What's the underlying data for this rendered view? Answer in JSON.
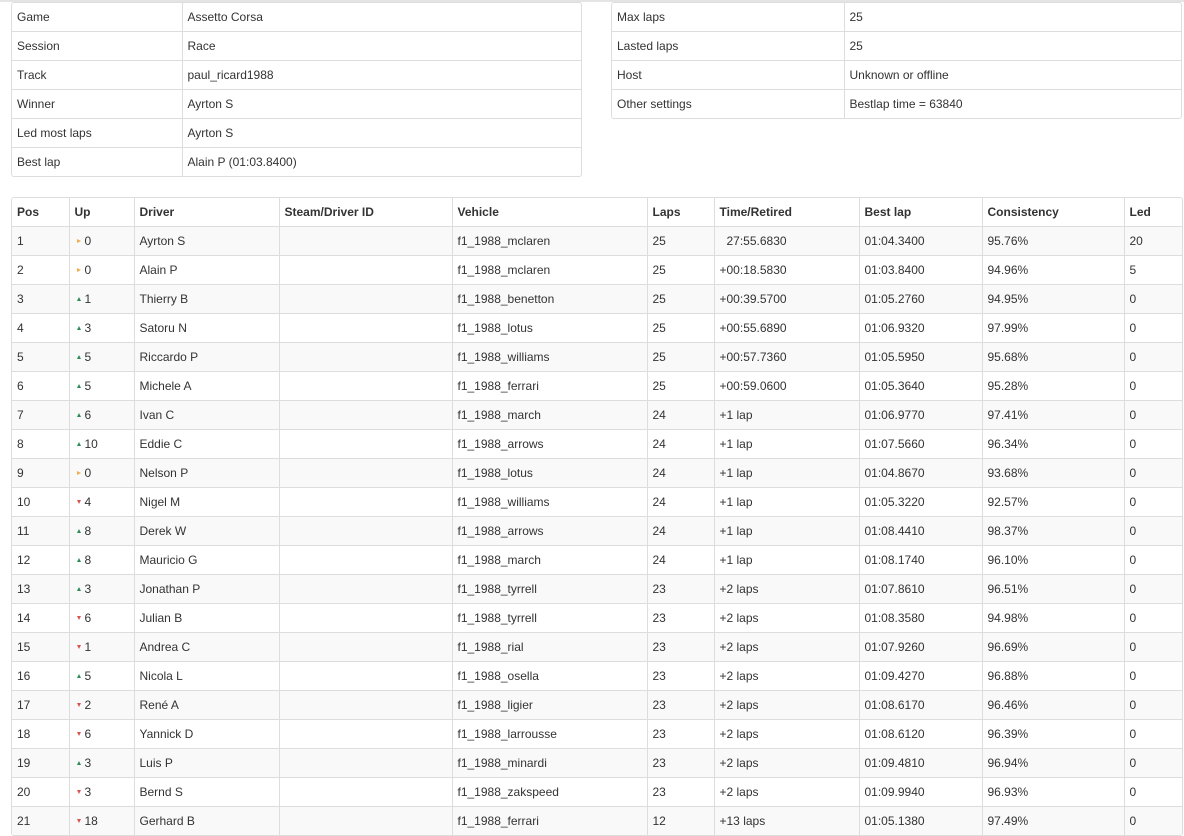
{
  "colors": {
    "border": "#dddddd",
    "stripe": "#f9f9f9",
    "up": "#2e8b57",
    "down": "#d9534f",
    "same": "#f0ad4e"
  },
  "icons": {
    "up": "triangle-up-icon",
    "down": "triangle-down-icon",
    "same": "triangle-right-icon"
  },
  "session_info": [
    {
      "label": "Game",
      "value": "Assetto Corsa"
    },
    {
      "label": "Session",
      "value": "Race"
    },
    {
      "label": "Track",
      "value": "paul_ricard1988"
    },
    {
      "label": "Winner",
      "value": "Ayrton S"
    },
    {
      "label": "Led most laps",
      "value": "Ayrton S"
    },
    {
      "label": "Best lap",
      "value": "Alain P (01:03.8400)"
    }
  ],
  "race_settings": [
    {
      "label": "Max laps",
      "value": "25"
    },
    {
      "label": "Lasted laps",
      "value": "25"
    },
    {
      "label": "Host",
      "value": "Unknown or offline"
    },
    {
      "label": "Other settings",
      "value": "Bestlap time = 63840"
    }
  ],
  "results": {
    "columns": [
      "Pos",
      "Up",
      "Driver",
      "Steam/Driver ID",
      "Vehicle",
      "Laps",
      "Time/Retired",
      "Best lap",
      "Consistency",
      "Led"
    ],
    "rows": [
      {
        "pos": "1",
        "up_dir": "same",
        "up": "0",
        "driver": "Ayrton S",
        "steam_id": "",
        "vehicle": "f1_1988_mclaren",
        "laps": "25",
        "time": "27:55.6830",
        "best_lap": "01:04.3400",
        "consistency": "95.76%",
        "led": "20"
      },
      {
        "pos": "2",
        "up_dir": "same",
        "up": "0",
        "driver": "Alain P",
        "steam_id": "",
        "vehicle": "f1_1988_mclaren",
        "laps": "25",
        "time": "+00:18.5830",
        "best_lap": "01:03.8400",
        "consistency": "94.96%",
        "led": "5"
      },
      {
        "pos": "3",
        "up_dir": "up",
        "up": "1",
        "driver": "Thierry B",
        "steam_id": "",
        "vehicle": "f1_1988_benetton",
        "laps": "25",
        "time": "+00:39.5700",
        "best_lap": "01:05.2760",
        "consistency": "94.95%",
        "led": "0"
      },
      {
        "pos": "4",
        "up_dir": "up",
        "up": "3",
        "driver": "Satoru N",
        "steam_id": "",
        "vehicle": "f1_1988_lotus",
        "laps": "25",
        "time": "+00:55.6890",
        "best_lap": "01:06.9320",
        "consistency": "97.99%",
        "led": "0"
      },
      {
        "pos": "5",
        "up_dir": "up",
        "up": "5",
        "driver": "Riccardo P",
        "steam_id": "",
        "vehicle": "f1_1988_williams",
        "laps": "25",
        "time": "+00:57.7360",
        "best_lap": "01:05.5950",
        "consistency": "95.68%",
        "led": "0"
      },
      {
        "pos": "6",
        "up_dir": "up",
        "up": "5",
        "driver": "Michele A",
        "steam_id": "",
        "vehicle": "f1_1988_ferrari",
        "laps": "25",
        "time": "+00:59.0600",
        "best_lap": "01:05.3640",
        "consistency": "95.28%",
        "led": "0"
      },
      {
        "pos": "7",
        "up_dir": "up",
        "up": "6",
        "driver": "Ivan C",
        "steam_id": "",
        "vehicle": "f1_1988_march",
        "laps": "24",
        "time": "+1 lap",
        "best_lap": "01:06.9770",
        "consistency": "97.41%",
        "led": "0"
      },
      {
        "pos": "8",
        "up_dir": "up",
        "up": "10",
        "driver": "Eddie C",
        "steam_id": "",
        "vehicle": "f1_1988_arrows",
        "laps": "24",
        "time": "+1 lap",
        "best_lap": "01:07.5660",
        "consistency": "96.34%",
        "led": "0"
      },
      {
        "pos": "9",
        "up_dir": "same",
        "up": "0",
        "driver": "Nelson P",
        "steam_id": "",
        "vehicle": "f1_1988_lotus",
        "laps": "24",
        "time": "+1 lap",
        "best_lap": "01:04.8670",
        "consistency": "93.68%",
        "led": "0"
      },
      {
        "pos": "10",
        "up_dir": "down",
        "up": "4",
        "driver": "Nigel M",
        "steam_id": "",
        "vehicle": "f1_1988_williams",
        "laps": "24",
        "time": "+1 lap",
        "best_lap": "01:05.3220",
        "consistency": "92.57%",
        "led": "0"
      },
      {
        "pos": "11",
        "up_dir": "up",
        "up": "8",
        "driver": "Derek W",
        "steam_id": "",
        "vehicle": "f1_1988_arrows",
        "laps": "24",
        "time": "+1 lap",
        "best_lap": "01:08.4410",
        "consistency": "98.37%",
        "led": "0"
      },
      {
        "pos": "12",
        "up_dir": "up",
        "up": "8",
        "driver": "Mauricio G",
        "steam_id": "",
        "vehicle": "f1_1988_march",
        "laps": "24",
        "time": "+1 lap",
        "best_lap": "01:08.1740",
        "consistency": "96.10%",
        "led": "0"
      },
      {
        "pos": "13",
        "up_dir": "up",
        "up": "3",
        "driver": "Jonathan P",
        "steam_id": "",
        "vehicle": "f1_1988_tyrrell",
        "laps": "23",
        "time": "+2 laps",
        "best_lap": "01:07.8610",
        "consistency": "96.51%",
        "led": "0"
      },
      {
        "pos": "14",
        "up_dir": "down",
        "up": "6",
        "driver": "Julian B",
        "steam_id": "",
        "vehicle": "f1_1988_tyrrell",
        "laps": "23",
        "time": "+2 laps",
        "best_lap": "01:08.3580",
        "consistency": "94.98%",
        "led": "0"
      },
      {
        "pos": "15",
        "up_dir": "down",
        "up": "1",
        "driver": "Andrea C",
        "steam_id": "",
        "vehicle": "f1_1988_rial",
        "laps": "23",
        "time": "+2 laps",
        "best_lap": "01:07.9260",
        "consistency": "96.69%",
        "led": "0"
      },
      {
        "pos": "16",
        "up_dir": "up",
        "up": "5",
        "driver": "Nicola L",
        "steam_id": "",
        "vehicle": "f1_1988_osella",
        "laps": "23",
        "time": "+2 laps",
        "best_lap": "01:09.4270",
        "consistency": "96.88%",
        "led": "0"
      },
      {
        "pos": "17",
        "up_dir": "down",
        "up": "2",
        "driver": "René A",
        "steam_id": "",
        "vehicle": "f1_1988_ligier",
        "laps": "23",
        "time": "+2 laps",
        "best_lap": "01:08.6170",
        "consistency": "96.46%",
        "led": "0"
      },
      {
        "pos": "18",
        "up_dir": "down",
        "up": "6",
        "driver": "Yannick D",
        "steam_id": "",
        "vehicle": "f1_1988_larrousse",
        "laps": "23",
        "time": "+2 laps",
        "best_lap": "01:08.6120",
        "consistency": "96.39%",
        "led": "0"
      },
      {
        "pos": "19",
        "up_dir": "up",
        "up": "3",
        "driver": "Luis P",
        "steam_id": "",
        "vehicle": "f1_1988_minardi",
        "laps": "23",
        "time": "+2 laps",
        "best_lap": "01:09.4810",
        "consistency": "96.94%",
        "led": "0"
      },
      {
        "pos": "20",
        "up_dir": "down",
        "up": "3",
        "driver": "Bernd S",
        "steam_id": "",
        "vehicle": "f1_1988_zakspeed",
        "laps": "23",
        "time": "+2 laps",
        "best_lap": "01:09.9940",
        "consistency": "96.93%",
        "led": "0"
      },
      {
        "pos": "21",
        "up_dir": "down",
        "up": "18",
        "driver": "Gerhard B",
        "steam_id": "",
        "vehicle": "f1_1988_ferrari",
        "laps": "12",
        "time": "+13 laps",
        "best_lap": "01:05.1380",
        "consistency": "97.49%",
        "led": "0"
      }
    ]
  }
}
